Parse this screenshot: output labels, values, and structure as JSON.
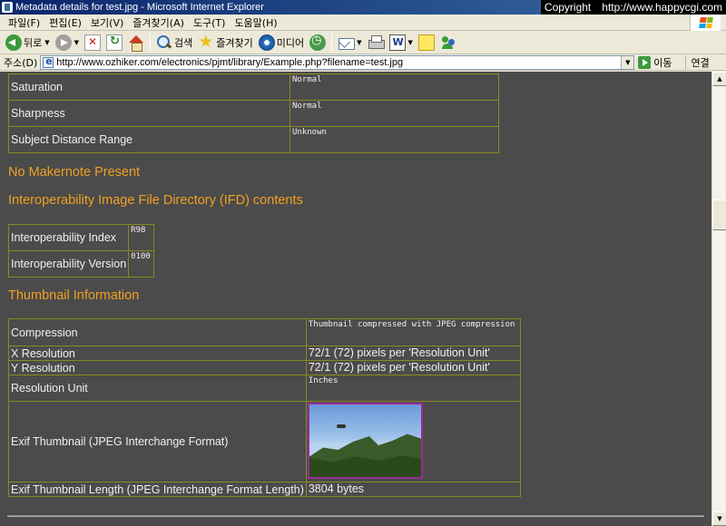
{
  "window": {
    "title": "Metadata details for test.jpg - Microsoft Internet Explorer",
    "copyright": "Copyright",
    "copyright_url": "http://www.happycgi.com"
  },
  "menu": [
    "파일(F)",
    "편집(E)",
    "보기(V)",
    "즐겨찾기(A)",
    "도구(T)",
    "도움말(H)"
  ],
  "toolbar": {
    "back_label": "뒤로",
    "search_label": "검색",
    "favorites_label": "즐겨찾기",
    "media_label": "미디어"
  },
  "address": {
    "label": "주소(D)",
    "url": "http://www.ozhiker.com/electronics/pjmt/library/Example.php?filename=test.jpg",
    "go_label": "이동",
    "links_label": "연결"
  },
  "exif_rows": [
    {
      "label": "Saturation",
      "value": "Normal"
    },
    {
      "label": "Sharpness",
      "value": "Normal"
    },
    {
      "label": "Subject Distance Range",
      "value": "Unknown"
    }
  ],
  "headings": {
    "makernote": "No Makernote Present",
    "interop": "Interoperability Image File Directory (IFD) contents",
    "thumbnail": "Thumbnail Information"
  },
  "interop_rows": [
    {
      "label": "Interoperability Index",
      "value": "R98"
    },
    {
      "label": "Interoperability Version",
      "value": "0100"
    }
  ],
  "thumb_rows": {
    "compression": {
      "label": "Compression",
      "value": "Thumbnail compressed with JPEG compression"
    },
    "x_res": {
      "label": "X Resolution",
      "value": "72/1 (72) pixels per 'Resolution Unit'"
    },
    "y_res": {
      "label": "Y Resolution",
      "value": "72/1 (72) pixels per 'Resolution Unit'"
    },
    "res_unit": {
      "label": "Resolution Unit",
      "value": "Inches"
    },
    "exif_thumb": {
      "label": "Exif Thumbnail (JPEG Interchange Format)"
    },
    "thumb_len": {
      "label": "Exif Thumbnail Length (JPEG Interchange Format Length)",
      "value": "3804 bytes"
    }
  }
}
